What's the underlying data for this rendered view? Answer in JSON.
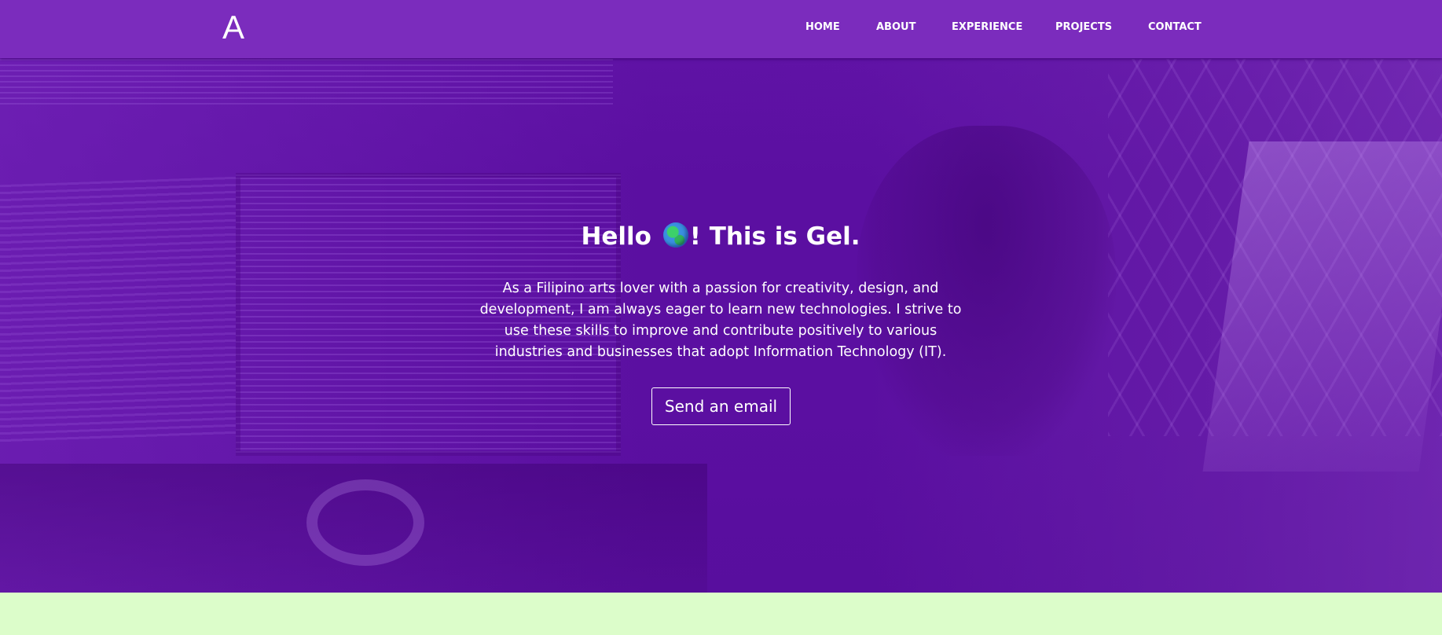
{
  "logo": {
    "letter": "A"
  },
  "nav": {
    "items": [
      {
        "label": "HOME"
      },
      {
        "label": "ABOUT"
      },
      {
        "label": "EXPERIENCE"
      },
      {
        "label": "PROJECTS"
      },
      {
        "label": "CONTACT"
      }
    ]
  },
  "hero": {
    "greeting": "Hello",
    "globe_icon": "earth-globe-icon",
    "title_rest": "! This is Gel.",
    "description": "As a Filipino arts lover with a passion for creativity, design, and development, I am always eager to learn new technologies. I strive to use these skills to improve and contribute positively to various industries and businesses that adopt Information Technology (IT).",
    "button_label": "Send an email"
  },
  "colors": {
    "navbar": "#7b2cbd",
    "hero_overlay": "#5b0fa1",
    "next_section": "#dcfdca",
    "text": "#ffffff"
  }
}
